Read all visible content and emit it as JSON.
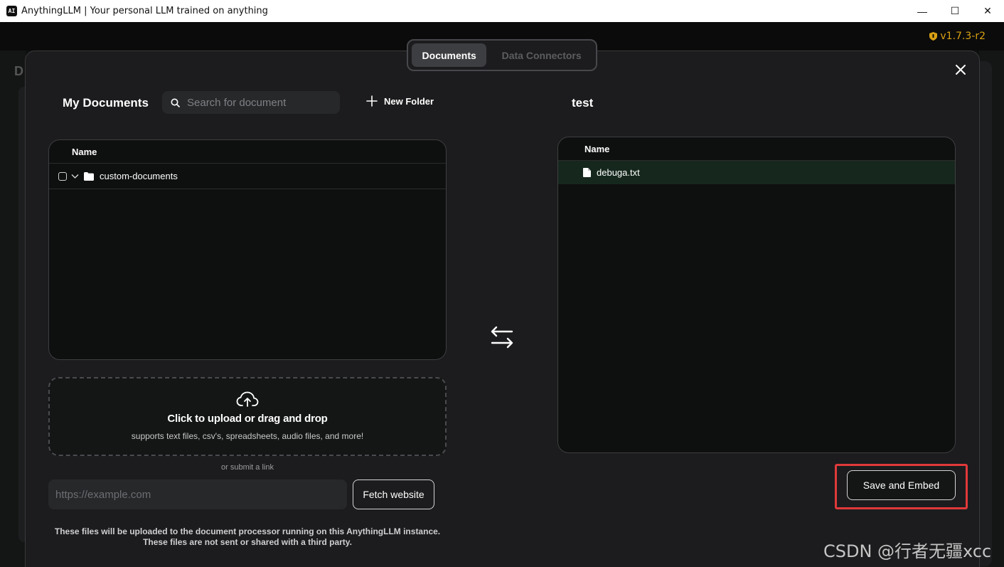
{
  "window": {
    "app_icon_text": "AI",
    "title": "AnythingLLM | Your personal LLM trained on anything",
    "minimize_glyph": "—",
    "maximize_glyph": "☐",
    "close_glyph": "✕"
  },
  "header": {
    "version": "v1.7.3-r2",
    "version_color": "#d9a013",
    "version_icon": "shield-icon"
  },
  "background": {
    "letter": "D"
  },
  "modal": {
    "tabs": [
      {
        "label": "Documents",
        "active": true
      },
      {
        "label": "Data Connectors",
        "active": false
      }
    ],
    "close_icon": "close-icon",
    "my_documents": {
      "title": "My Documents",
      "search_placeholder": "Search for document",
      "new_folder_label": "New Folder",
      "column_header": "Name",
      "rows": [
        {
          "name": "custom-documents",
          "type": "folder",
          "checked": false,
          "expanded": false
        }
      ]
    },
    "upload": {
      "title": "Click to upload or drag and drop",
      "subtitle": "supports text files, csv's, spreadsheets, audio files, and more!",
      "or_link": "or submit a link",
      "url_placeholder": "https://example.com",
      "fetch_label": "Fetch website",
      "disclaimer_line1": "These files will be uploaded to the document processor running on this AnythingLLM instance.",
      "disclaimer_line2": "These files are not sent or shared with a third party."
    },
    "workspace": {
      "title": "test",
      "column_header": "Name",
      "rows": [
        {
          "name": "debuga.txt",
          "type": "file",
          "highlight_color": "#16281d"
        }
      ]
    },
    "save_label": "Save and Embed",
    "highlight_color": "#e0393a"
  },
  "watermark": "CSDN @行者无疆xcc"
}
